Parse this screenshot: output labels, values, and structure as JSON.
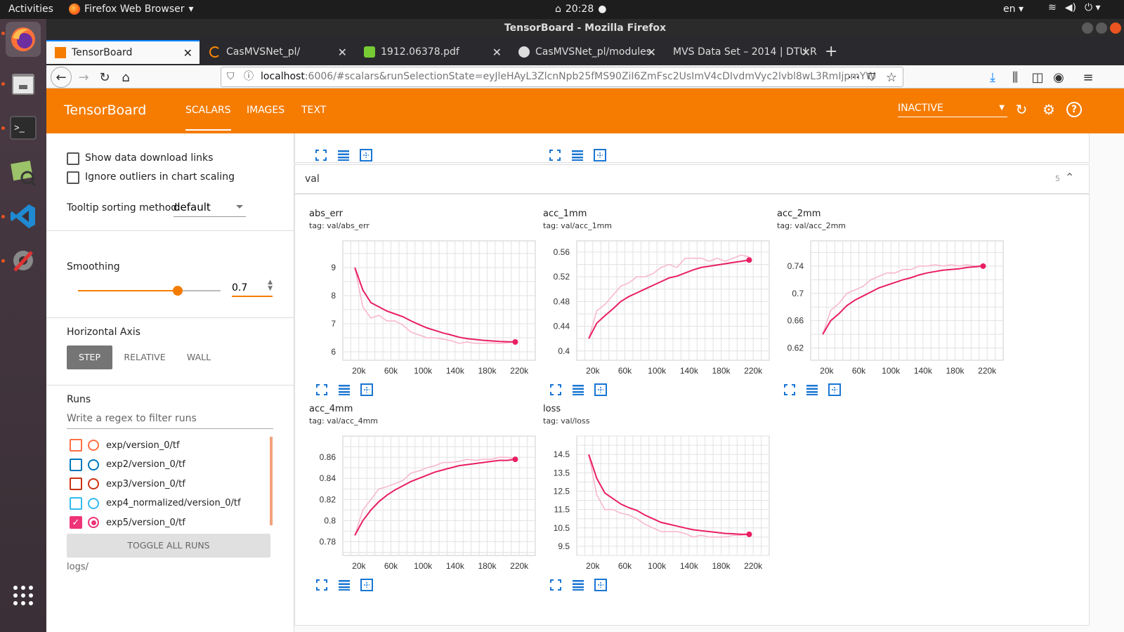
{
  "desktop": {
    "activities": "Activities",
    "app_name": "Firefox Web Browser",
    "clock": "20:28",
    "lang": "en"
  },
  "window": {
    "title": "TensorBoard - Mozilla Firefox"
  },
  "tabs": [
    {
      "label": "TensorBoard",
      "selected": true,
      "icon": "tensorboard-icon"
    },
    {
      "label": "CasMVSNet_pl/",
      "selected": false,
      "icon": "loading-icon"
    },
    {
      "label": "1912.06378.pdf",
      "selected": false,
      "icon": "pdf-icon"
    },
    {
      "label": "CasMVSNet_pl/modules",
      "selected": false,
      "icon": "github-icon"
    },
    {
      "label": "MVS Data Set – 2014 | DTU R",
      "selected": false,
      "icon": "page-icon"
    }
  ],
  "url": {
    "host": "localhost",
    "rest": ":6006/#scalars&runSelectionState=eyJleHAyL3ZlcnNpb25fMS90ZiI6ZmFsc2UsImV4cDIvdmVyc2lvbl8wL3RmIjpmYW"
  },
  "tensorboard": {
    "brand": "TensorBoard",
    "nav": [
      "SCALARS",
      "IMAGES",
      "TEXT"
    ],
    "status": "INACTIVE",
    "accent": "#f57c00"
  },
  "sidebar": {
    "show_download": "Show data download links",
    "ignore_outliers": "Ignore outliers in chart scaling",
    "tooltip_label": "Tooltip sorting method:",
    "tooltip_value": "default",
    "smoothing_label": "Smoothing",
    "smoothing_value": "0.7",
    "smoothing_fraction": 0.7,
    "haxis_label": "Horizontal Axis",
    "haxis_options": [
      "STEP",
      "RELATIVE",
      "WALL"
    ],
    "runs_label": "Runs",
    "filter_placeholder": "Write a regex to filter runs",
    "runs": [
      {
        "name": "exp/version_0/tf",
        "color": "#ff7043",
        "checked": false
      },
      {
        "name": "exp2/version_0/tf",
        "color": "#0077bb",
        "checked": false
      },
      {
        "name": "exp3/version_0/tf",
        "color": "#cc3311",
        "checked": false
      },
      {
        "name": "exp4_normalized/version_0/tf",
        "color": "#33bbee",
        "checked": false
      },
      {
        "name": "exp5/version_0/tf",
        "color": "#ee3377",
        "checked": true
      }
    ],
    "toggle_all": "TOGGLE ALL RUNS",
    "logdir": "logs/"
  },
  "group": {
    "name": "val",
    "count": "5"
  },
  "chart_data": [
    {
      "type": "line",
      "title": "abs_err",
      "tag": "tag: val/abs_err",
      "xticks": [
        "20k",
        "60k",
        "100k",
        "140k",
        "180k",
        "220k"
      ],
      "xlim": [
        0,
        240000
      ],
      "yticks": [
        "9",
        "8",
        "7",
        "6"
      ],
      "ylim": [
        5.7,
        9.95
      ],
      "series": [
        {
          "role": "raw",
          "x": [
            15000,
            25000,
            35000,
            45000,
            55000,
            65000,
            75000,
            85000,
            95000,
            105000,
            115000,
            125000,
            135000,
            145000,
            155000,
            165000,
            175000,
            185000,
            195000,
            205000,
            215000
          ],
          "values": [
            9.0,
            7.6,
            7.2,
            7.3,
            7.1,
            7.1,
            6.95,
            6.7,
            6.6,
            6.5,
            6.5,
            6.45,
            6.4,
            6.3,
            6.35,
            6.3,
            6.3,
            6.32,
            6.3,
            6.32,
            6.35
          ]
        },
        {
          "role": "smoothed",
          "x": [
            15000,
            25000,
            35000,
            45000,
            55000,
            65000,
            75000,
            85000,
            95000,
            105000,
            115000,
            125000,
            135000,
            145000,
            155000,
            165000,
            175000,
            185000,
            195000,
            205000,
            215000
          ],
          "values": [
            9.0,
            8.2,
            7.75,
            7.6,
            7.45,
            7.35,
            7.25,
            7.1,
            6.97,
            6.85,
            6.76,
            6.67,
            6.6,
            6.52,
            6.47,
            6.44,
            6.41,
            6.39,
            6.37,
            6.36,
            6.35
          ]
        }
      ]
    },
    {
      "type": "line",
      "title": "acc_1mm",
      "tag": "tag: val/acc_1mm",
      "xticks": [
        "20k",
        "60k",
        "100k",
        "140k",
        "180k",
        "220k"
      ],
      "xlim": [
        0,
        240000
      ],
      "yticks": [
        "0.56",
        "0.52",
        "0.48",
        "0.44",
        "0.4"
      ],
      "ylim": [
        0.385,
        0.578
      ],
      "series": [
        {
          "role": "raw",
          "x": [
            15000,
            25000,
            35000,
            45000,
            55000,
            65000,
            75000,
            85000,
            95000,
            105000,
            115000,
            125000,
            135000,
            145000,
            155000,
            165000,
            175000,
            185000,
            195000,
            205000,
            215000
          ],
          "values": [
            0.42,
            0.465,
            0.475,
            0.49,
            0.505,
            0.51,
            0.52,
            0.52,
            0.525,
            0.535,
            0.54,
            0.535,
            0.55,
            0.55,
            0.55,
            0.545,
            0.55,
            0.545,
            0.55,
            0.555,
            0.552
          ]
        },
        {
          "role": "smoothed",
          "x": [
            15000,
            25000,
            35000,
            45000,
            55000,
            65000,
            75000,
            85000,
            95000,
            105000,
            115000,
            125000,
            135000,
            145000,
            155000,
            165000,
            175000,
            185000,
            195000,
            205000,
            215000
          ],
          "values": [
            0.42,
            0.445,
            0.457,
            0.468,
            0.48,
            0.488,
            0.494,
            0.5,
            0.506,
            0.512,
            0.518,
            0.521,
            0.526,
            0.531,
            0.535,
            0.537,
            0.539,
            0.541,
            0.543,
            0.545,
            0.547
          ]
        }
      ]
    },
    {
      "type": "line",
      "title": "acc_2mm",
      "tag": "tag: val/acc_2mm",
      "xticks": [
        "20k",
        "60k",
        "100k",
        "140k",
        "180k",
        "220k"
      ],
      "xlim": [
        0,
        240000
      ],
      "yticks": [
        "0.74",
        "0.7",
        "0.66",
        "0.62"
      ],
      "ylim": [
        0.602,
        0.777
      ],
      "series": [
        {
          "role": "raw",
          "x": [
            15000,
            25000,
            35000,
            45000,
            55000,
            65000,
            75000,
            85000,
            95000,
            105000,
            115000,
            125000,
            135000,
            145000,
            155000,
            165000,
            175000,
            185000,
            195000,
            205000,
            215000
          ],
          "values": [
            0.64,
            0.675,
            0.685,
            0.7,
            0.705,
            0.71,
            0.72,
            0.725,
            0.73,
            0.73,
            0.735,
            0.735,
            0.74,
            0.74,
            0.742,
            0.74,
            0.742,
            0.74,
            0.742,
            0.74,
            0.741
          ]
        },
        {
          "role": "smoothed",
          "x": [
            15000,
            25000,
            35000,
            45000,
            55000,
            65000,
            75000,
            85000,
            95000,
            105000,
            115000,
            125000,
            135000,
            145000,
            155000,
            165000,
            175000,
            185000,
            195000,
            205000,
            215000
          ],
          "values": [
            0.64,
            0.66,
            0.67,
            0.682,
            0.69,
            0.696,
            0.702,
            0.708,
            0.712,
            0.716,
            0.72,
            0.723,
            0.727,
            0.73,
            0.732,
            0.734,
            0.735,
            0.736,
            0.738,
            0.739,
            0.74
          ]
        }
      ]
    },
    {
      "type": "line",
      "title": "acc_4mm",
      "tag": "tag: val/acc_4mm",
      "xticks": [
        "20k",
        "60k",
        "100k",
        "140k",
        "180k",
        "220k"
      ],
      "xlim": [
        0,
        240000
      ],
      "yticks": [
        "0.86",
        "0.84",
        "0.82",
        "0.8",
        "0.78"
      ],
      "ylim": [
        0.767,
        0.88
      ],
      "series": [
        {
          "role": "raw",
          "x": [
            15000,
            25000,
            35000,
            45000,
            55000,
            65000,
            75000,
            85000,
            95000,
            105000,
            115000,
            125000,
            135000,
            145000,
            155000,
            165000,
            175000,
            185000,
            195000,
            205000,
            215000
          ],
          "values": [
            0.786,
            0.81,
            0.82,
            0.83,
            0.832,
            0.835,
            0.838,
            0.845,
            0.847,
            0.85,
            0.852,
            0.855,
            0.855,
            0.856,
            0.858,
            0.857,
            0.858,
            0.858,
            0.86,
            0.86,
            0.858
          ]
        },
        {
          "role": "smoothed",
          "x": [
            15000,
            25000,
            35000,
            45000,
            55000,
            65000,
            75000,
            85000,
            95000,
            105000,
            115000,
            125000,
            135000,
            145000,
            155000,
            165000,
            175000,
            185000,
            195000,
            205000,
            215000
          ],
          "values": [
            0.786,
            0.8,
            0.81,
            0.818,
            0.824,
            0.829,
            0.833,
            0.837,
            0.84,
            0.843,
            0.846,
            0.848,
            0.85,
            0.852,
            0.853,
            0.854,
            0.855,
            0.856,
            0.857,
            0.857,
            0.858
          ]
        }
      ]
    },
    {
      "type": "line",
      "title": "loss",
      "tag": "tag: val/loss",
      "xticks": [
        "20k",
        "60k",
        "100k",
        "140k",
        "180k",
        "220k"
      ],
      "xlim": [
        0,
        240000
      ],
      "yticks": [
        "14.5",
        "13.5",
        "12.5",
        "11.5",
        "10.5",
        "9.5"
      ],
      "ylim": [
        9.0,
        15.5
      ],
      "series": [
        {
          "role": "raw",
          "x": [
            15000,
            25000,
            35000,
            45000,
            55000,
            65000,
            75000,
            85000,
            95000,
            105000,
            115000,
            125000,
            135000,
            145000,
            155000,
            165000,
            175000,
            185000,
            195000,
            205000,
            215000
          ],
          "values": [
            14.5,
            12.3,
            11.5,
            11.5,
            11.3,
            11.2,
            11.0,
            10.7,
            10.5,
            10.3,
            10.3,
            10.3,
            10.2,
            10.0,
            10.1,
            10.0,
            10.0,
            10.0,
            10.1,
            10.1,
            10.15
          ]
        },
        {
          "role": "smoothed",
          "x": [
            15000,
            25000,
            35000,
            45000,
            55000,
            65000,
            75000,
            85000,
            95000,
            105000,
            115000,
            125000,
            135000,
            145000,
            155000,
            165000,
            175000,
            185000,
            195000,
            205000,
            215000
          ],
          "values": [
            14.5,
            13.2,
            12.4,
            12.1,
            11.8,
            11.6,
            11.45,
            11.2,
            11.0,
            10.8,
            10.7,
            10.6,
            10.5,
            10.4,
            10.35,
            10.3,
            10.25,
            10.2,
            10.18,
            10.15,
            10.15
          ]
        }
      ]
    }
  ]
}
